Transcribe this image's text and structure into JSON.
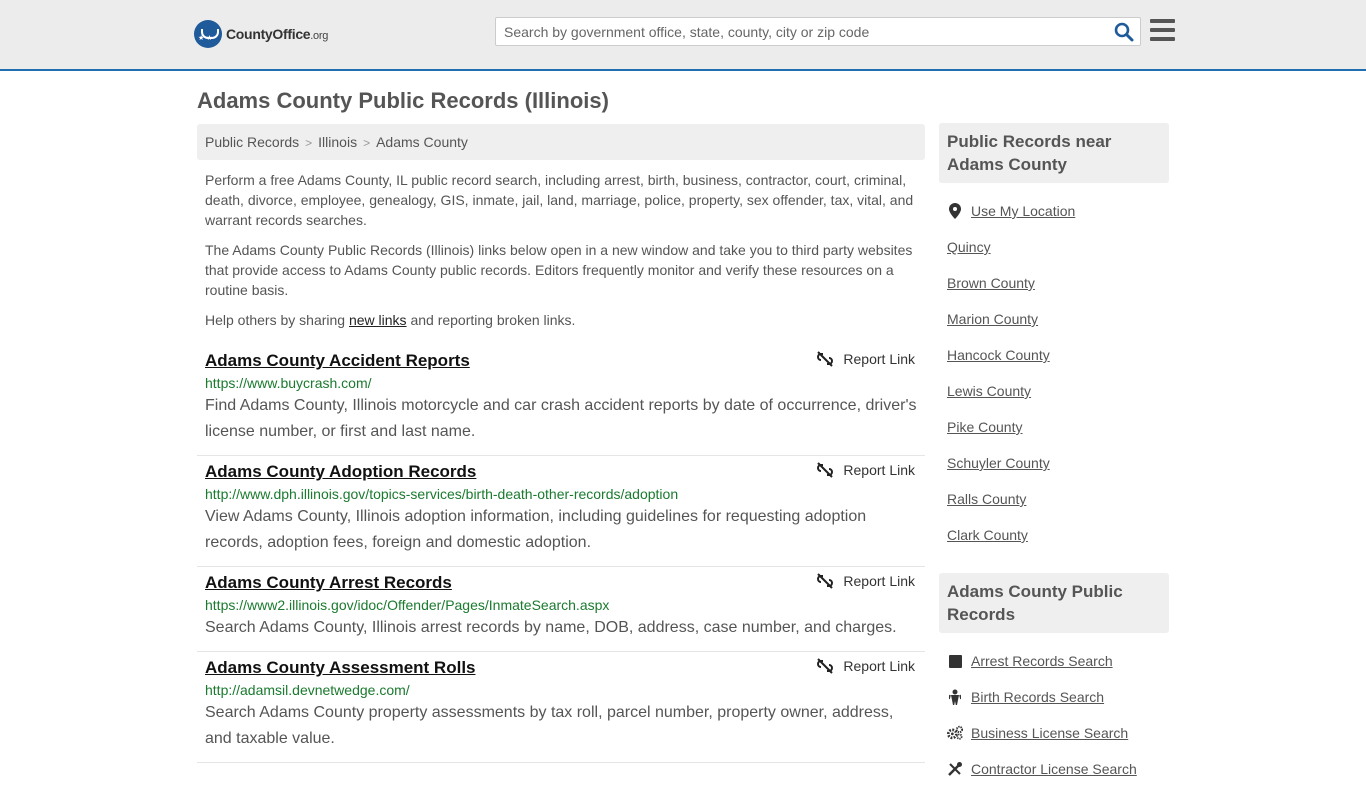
{
  "header": {
    "logo_text": "CountyOffice",
    "logo_tld": ".org",
    "search_placeholder": "Search by government office, state, county, city or zip code"
  },
  "page": {
    "title": "Adams County Public Records (Illinois)"
  },
  "breadcrumb": [
    "Public Records",
    "Illinois",
    "Adams County"
  ],
  "intro": {
    "p1": "Perform a free Adams County, IL public record search, including arrest, birth, business, contractor, court, criminal, death, divorce, employee, genealogy, GIS, inmate, jail, land, marriage, police, property, sex offender, tax, vital, and warrant records searches.",
    "p2": "The Adams County Public Records (Illinois) links below open in a new window and take you to third party websites that provide access to Adams County public records. Editors frequently monitor and verify these resources on a routine basis.",
    "p3_before": "Help others by sharing ",
    "p3_link": "new links",
    "p3_after": " and reporting broken links."
  },
  "report_label": "Report Link",
  "records": [
    {
      "title": "Adams County Accident Reports",
      "url": "https://www.buycrash.com/",
      "desc": "Find Adams County, Illinois motorcycle and car crash accident reports by date of occurrence, driver's license number, or first and last name."
    },
    {
      "title": "Adams County Adoption Records",
      "url": "http://www.dph.illinois.gov/topics-services/birth-death-other-records/adoption",
      "desc": "View Adams County, Illinois adoption information, including guidelines for requesting adoption records, adoption fees, foreign and domestic adoption."
    },
    {
      "title": "Adams County Arrest Records",
      "url": "https://www2.illinois.gov/idoc/Offender/Pages/InmateSearch.aspx",
      "desc": "Search Adams County, Illinois arrest records by name, DOB, address, case number, and charges."
    },
    {
      "title": "Adams County Assessment Rolls",
      "url": "http://adamsil.devnetwedge.com/",
      "desc": "Search Adams County property assessments by tax roll, parcel number, property owner, address, and taxable value."
    }
  ],
  "sidebar": {
    "near_heading": "Public Records near Adams County",
    "location_label": "Use My Location",
    "near_links": [
      "Quincy",
      "Brown County",
      "Marion County",
      "Hancock County",
      "Lewis County",
      "Pike County",
      "Schuyler County",
      "Ralls County",
      "Clark County"
    ],
    "county_heading": "Adams County Public Records",
    "county_links": [
      {
        "label": "Arrest Records Search",
        "icon": "square-icon"
      },
      {
        "label": "Birth Records Search",
        "icon": "baby-icon"
      },
      {
        "label": "Business License Search",
        "icon": "gears-icon"
      },
      {
        "label": "Contractor License Search",
        "icon": "tools-icon"
      }
    ]
  },
  "colors": {
    "accent": "#1f6eb0",
    "url_green": "#1a7a2e",
    "header_bg": "#ececec"
  }
}
